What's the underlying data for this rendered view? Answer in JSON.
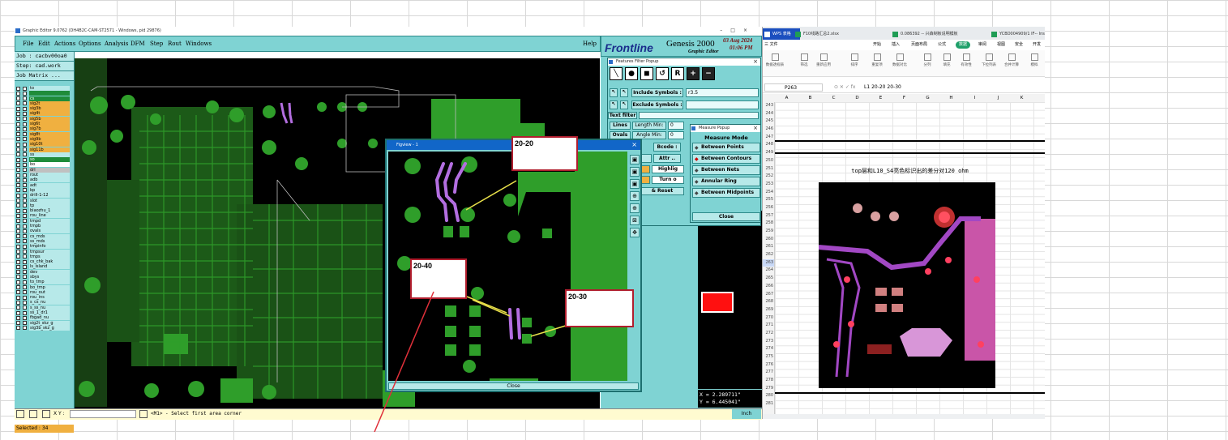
{
  "genesis": {
    "window_title": "Graphic Editor 9.0762 (DH4B2C-CAM-ST2571 - Windows, pid 29876)",
    "menu": [
      "File",
      "Edit",
      "Actions",
      "Options",
      "Analysis",
      "DFM",
      "Step",
      "Rout",
      "Windows"
    ],
    "help": "Help",
    "brand": {
      "logo": "Frontline",
      "name": "Genesis 2000",
      "sub": "Graphic Editor",
      "date": "03 Aug 2024",
      "time": "01:06 PM"
    },
    "job": "Job : cacbv00oa0",
    "step": "Step: cad.work",
    "job_matrix": "Job Matrix ...",
    "layers": [
      "to",
      "",
      "cs",
      "sig2t",
      "sig3b",
      "sig4t",
      "sig5b",
      "sig6t",
      "sig7b",
      "sig8t",
      "sig9b",
      "sig10t",
      "sig11b",
      "ss",
      "so",
      "bo",
      "drl",
      "rout",
      "adb",
      "adt",
      "bp",
      "drill-1-12",
      "slot",
      "tp",
      "biaozhu_1",
      "rou_line",
      "tmpd",
      "tmpb",
      "ovals",
      "cs_mds",
      "ss_mds",
      "tmpinfo",
      "tmpsur",
      "tmps",
      "cs_chk_bak",
      "ls_island",
      "dev",
      "sbys",
      "to_tmp",
      "bo_tmp",
      "rou_out",
      "rou_ins",
      "s_cs_nu",
      "s_ss_nu",
      "ss_1_dr1",
      "fbgad_nu",
      "sig2t_skz_g",
      "sig3b_skz_g"
    ],
    "selected": "Selected : 34",
    "status": {
      "xy_label": "X Y :",
      "message": "<M1> - Select first area corner",
      "units": "Inch"
    },
    "coords": {
      "x": "X = 2.289711\"",
      "y": "Y = 6.445041\""
    }
  },
  "feature_filter": {
    "title": "Features Filter Popup",
    "include_label": "Include Symbols :",
    "include_value": "r3.5",
    "exclude_label": "Exclude Symbols :",
    "text_filter_label": "Text filter",
    "lines_label": "Lines",
    "ovals_label": "Ovals",
    "length_label": "Length  Min:",
    "length_min": "0",
    "angle_label": "Angle   Min:",
    "angle_min": "0",
    "bcode": "Bcode :",
    "attr": "Attr ..",
    "highlight": "Highlig",
    "turn_off": "Turn o",
    "reset": "& Reset"
  },
  "measure": {
    "title": "Measure Popup",
    "mode_label": "Measure Mode",
    "modes": [
      "Between Points",
      "Between Contours",
      "Between Nets",
      "Annular Ring",
      "Between Midpoints"
    ],
    "active_mode": 1,
    "close": "Close"
  },
  "figview": {
    "title": "Figview - 1",
    "close": "Close",
    "callouts": [
      "20-20",
      "20-40",
      "20-30"
    ]
  },
  "spreadsheet": {
    "tabs": [
      "WPS 表格",
      "F10线路汇总2.xlsx",
      "0.086392 -- 兴森制板说明模板",
      "YCBD004909/1 IF--  Ins"
    ],
    "menu": [
      "三 文件",
      "开始",
      "插入",
      "页面布局",
      "公式",
      "数据",
      "审阅",
      "视图",
      "安全",
      "开发"
    ],
    "active_menu": "数据",
    "ribbon_buttons": [
      "数据透视表",
      "筛选",
      "重新应用",
      "排序",
      "重复项",
      "数据对比",
      "分列",
      "填充",
      "有效性",
      "下拉列表",
      "合并计算",
      "模拟"
    ],
    "cell_ref": "P263",
    "formula": "L1   20-20   20-30",
    "columns": [
      "A",
      "B",
      "C",
      "D",
      "E",
      "F",
      "G",
      "H",
      "I",
      "J",
      "K"
    ],
    "rows": [
      "243",
      "244",
      "245",
      "246",
      "247",
      "248",
      "249",
      "250",
      "251",
      "252",
      "253",
      "254",
      "255",
      "256",
      "257",
      "258",
      "259",
      "260",
      "261",
      "262",
      "263",
      "264",
      "265",
      "266",
      "267",
      "268",
      "269",
      "270",
      "271",
      "272",
      "273",
      "274",
      "275",
      "276",
      "277",
      "278",
      "279",
      "280",
      "281"
    ],
    "highlight_row": "263",
    "image_caption": "top层和L10_S4亮色标识出的差分对120 ohm"
  }
}
